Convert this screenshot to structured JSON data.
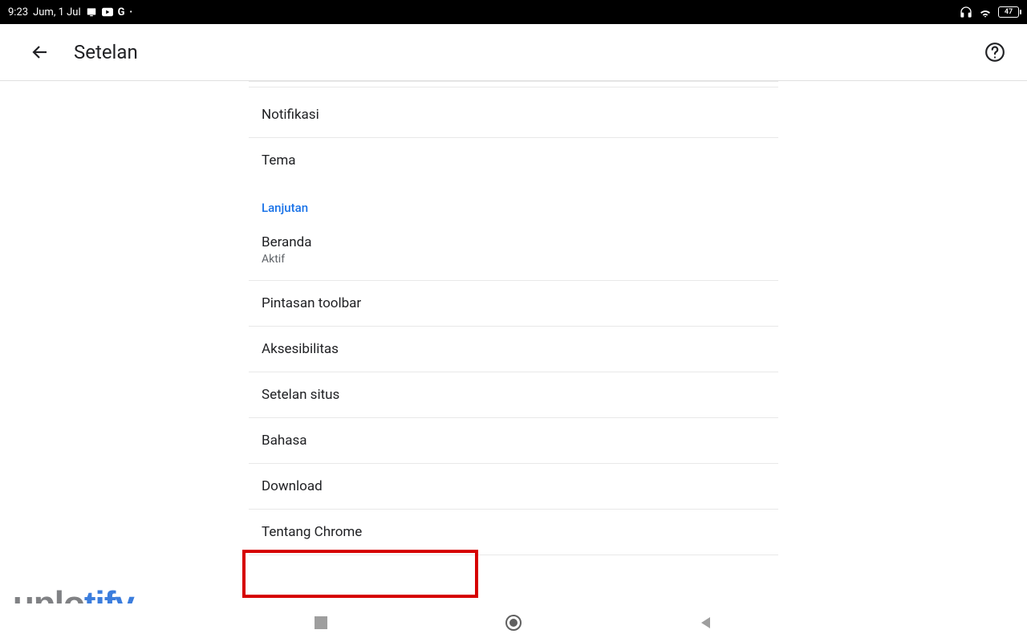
{
  "status": {
    "time": "9:23",
    "date": "Jum, 1 Jul",
    "battery": "47"
  },
  "header": {
    "title": "Setelan"
  },
  "settings": {
    "notifikasi": "Notifikasi",
    "tema": "Tema",
    "section_lanjutan": "Lanjutan",
    "beranda": {
      "title": "Beranda",
      "subtitle": "Aktif"
    },
    "pintasan": "Pintasan toolbar",
    "aksesibilitas": "Aksesibilitas",
    "setelan_situs": "Setelan situs",
    "bahasa": "Bahasa",
    "download": "Download",
    "tentang": "Tentang Chrome"
  },
  "watermark": {
    "part1": "uplo",
    "part2": "tify"
  }
}
